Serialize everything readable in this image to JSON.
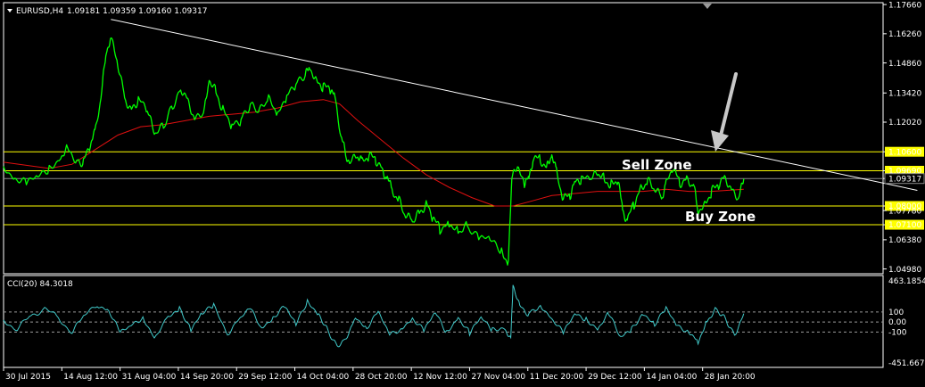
{
  "header": {
    "symbol": "EURUSD,H4",
    "ohlc": "1.09181 1.09359 1.09160 1.09317"
  },
  "indicator": {
    "label": "CCI(20) 84.3018",
    "y_ticks": [
      "463.1854",
      "100",
      "0.00",
      "-100",
      "-451.6679"
    ]
  },
  "annotations": {
    "sell_zone": "Sell Zone",
    "buy_zone": "Buy Zone"
  },
  "colors": {
    "background": "#000000",
    "price": "#00ff00",
    "moving_average": "#e01010",
    "trendline": "#ffffff",
    "level": "#ffff00",
    "cci": "#40c8c8",
    "arrow": "#c8c8c8"
  },
  "chart_data": {
    "type": "line",
    "x_ticks": [
      "30 Jul 2015",
      "14 Aug 12:00",
      "31 Aug 04:00",
      "14 Sep 20:00",
      "29 Sep 12:00",
      "14 Oct 04:00",
      "28 Oct 20:00",
      "12 Nov 12:00",
      "27 Nov 04:00",
      "11 Dec 20:00",
      "29 Dec 12:00",
      "14 Jan 04:00",
      "28 Jan 20:00"
    ],
    "y_ticks": [
      "1.17660",
      "1.16260",
      "1.14860",
      "1.13420",
      "1.12020",
      "1.10600",
      "1.09690",
      "1.09317",
      "1.08000",
      "1.07780",
      "1.07100",
      "1.06380",
      "1.04980"
    ],
    "ylim": [
      1.0475,
      1.1775
    ],
    "price_path": [
      [
        0,
        1.099
      ],
      [
        0.5,
        1.094
      ],
      [
        1,
        1.091
      ],
      [
        1.5,
        1.093
      ],
      [
        2,
        1.098
      ],
      [
        2.5,
        1.104
      ],
      [
        2.8,
        1.108
      ],
      [
        3.2,
        1.102
      ],
      [
        3.5,
        1.101
      ],
      [
        3.8,
        1.109
      ],
      [
        4.0,
        1.115
      ],
      [
        4.3,
        1.135
      ],
      [
        4.5,
        1.155
      ],
      [
        4.7,
        1.16
      ],
      [
        5.0,
        1.148
      ],
      [
        5.3,
        1.132
      ],
      [
        5.6,
        1.126
      ],
      [
        5.9,
        1.131
      ],
      [
        6.3,
        1.125
      ],
      [
        6.6,
        1.115
      ],
      [
        7.0,
        1.118
      ],
      [
        7.4,
        1.128
      ],
      [
        7.8,
        1.136
      ],
      [
        8.1,
        1.13
      ],
      [
        8.4,
        1.121
      ],
      [
        8.8,
        1.126
      ],
      [
        9.0,
        1.141
      ],
      [
        9.3,
        1.135
      ],
      [
        9.6,
        1.126
      ],
      [
        10.0,
        1.118
      ],
      [
        10.4,
        1.121
      ],
      [
        10.8,
        1.128
      ],
      [
        11.2,
        1.125
      ],
      [
        11.6,
        1.131
      ],
      [
        12.0,
        1.123
      ],
      [
        12.4,
        1.132
      ],
      [
        12.8,
        1.138
      ],
      [
        13.2,
        1.142
      ],
      [
        13.4,
        1.147
      ],
      [
        13.7,
        1.14
      ],
      [
        14.0,
        1.137
      ],
      [
        14.3,
        1.136
      ],
      [
        14.5,
        1.132
      ],
      [
        14.8,
        1.112
      ],
      [
        15.0,
        1.104
      ],
      [
        15.2,
        1.101
      ],
      [
        15.5,
        1.104
      ],
      [
        15.7,
        1.101
      ],
      [
        16.0,
        1.104
      ],
      [
        16.3,
        1.102
      ],
      [
        16.6,
        1.097
      ],
      [
        16.8,
        1.093
      ],
      [
        17.0,
        1.088
      ],
      [
        17.3,
        1.083
      ],
      [
        17.6,
        1.075
      ],
      [
        17.9,
        1.073
      ],
      [
        18.2,
        1.077
      ],
      [
        18.5,
        1.081
      ],
      [
        18.8,
        1.074
      ],
      [
        19.1,
        1.069
      ],
      [
        19.5,
        1.072
      ],
      [
        19.9,
        1.068
      ],
      [
        20.3,
        1.071
      ],
      [
        20.8,
        1.065
      ],
      [
        21.3,
        1.063
      ],
      [
        21.8,
        1.058
      ],
      [
        22.1,
        1.053
      ],
      [
        22.25,
        1.094
      ],
      [
        22.5,
        1.097
      ],
      [
        22.8,
        1.091
      ],
      [
        23.0,
        1.093
      ],
      [
        23.2,
        1.104
      ],
      [
        23.5,
        1.102
      ],
      [
        23.8,
        1.099
      ],
      [
        24.0,
        1.105
      ],
      [
        24.2,
        1.096
      ],
      [
        24.5,
        1.083
      ],
      [
        24.8,
        1.085
      ],
      [
        25.0,
        1.091
      ],
      [
        25.3,
        1.093
      ],
      [
        25.7,
        1.092
      ],
      [
        26.0,
        1.096
      ],
      [
        26.3,
        1.093
      ],
      [
        26.6,
        1.09
      ],
      [
        26.9,
        1.092
      ],
      [
        27.1,
        1.078
      ],
      [
        27.3,
        1.073
      ],
      [
        27.6,
        1.081
      ],
      [
        27.9,
        1.089
      ],
      [
        28.2,
        1.092
      ],
      [
        28.5,
        1.088
      ],
      [
        28.8,
        1.084
      ],
      [
        29.0,
        1.09
      ],
      [
        29.3,
        1.098
      ],
      [
        29.6,
        1.091
      ],
      [
        29.9,
        1.093
      ],
      [
        30.2,
        1.09
      ],
      [
        30.4,
        1.078
      ],
      [
        30.7,
        1.081
      ],
      [
        31.0,
        1.087
      ],
      [
        31.3,
        1.09
      ],
      [
        31.6,
        1.094
      ],
      [
        31.9,
        1.087
      ],
      [
        32.2,
        1.084
      ],
      [
        32.4,
        1.093
      ]
    ],
    "moving_average": [
      [
        0,
        1.101
      ],
      [
        2,
        1.098
      ],
      [
        3,
        1.1
      ],
      [
        4,
        1.107
      ],
      [
        5,
        1.114
      ],
      [
        6,
        1.118
      ],
      [
        7,
        1.119
      ],
      [
        8,
        1.121
      ],
      [
        9,
        1.123
      ],
      [
        10,
        1.124
      ],
      [
        11,
        1.125
      ],
      [
        12,
        1.127
      ],
      [
        13,
        1.13
      ],
      [
        14,
        1.131
      ],
      [
        14.7,
        1.129
      ],
      [
        15.5,
        1.121
      ],
      [
        16.5,
        1.112
      ],
      [
        17.5,
        1.103
      ],
      [
        18.5,
        1.095
      ],
      [
        19.5,
        1.089
      ],
      [
        20.5,
        1.084
      ],
      [
        21.5,
        1.08
      ],
      [
        22.3,
        1.08
      ],
      [
        23,
        1.082
      ],
      [
        24,
        1.085
      ],
      [
        25,
        1.086
      ],
      [
        26,
        1.087
      ],
      [
        27,
        1.087
      ],
      [
        28,
        1.087
      ],
      [
        29,
        1.088
      ],
      [
        30,
        1.087
      ],
      [
        31,
        1.087
      ],
      [
        32.4,
        1.088
      ]
    ],
    "trendline": [
      [
        4.7,
        1.1695
      ],
      [
        40.0,
        1.0875
      ]
    ],
    "levels": [
      1.106,
      1.0969,
      1.08,
      1.071
    ],
    "current_price": 1.09317,
    "cci_ylim": [
      -451.6679,
      463.1854
    ],
    "cci_levels": [
      100,
      0,
      -100
    ],
    "cci_path": [
      [
        0,
        20
      ],
      [
        0.6,
        -70
      ],
      [
        1.2,
        60
      ],
      [
        1.8,
        140
      ],
      [
        2.4,
        30
      ],
      [
        3.0,
        -90
      ],
      [
        3.5,
        40
      ],
      [
        4.1,
        180
      ],
      [
        4.6,
        120
      ],
      [
        5.1,
        -120
      ],
      [
        5.6,
        -40
      ],
      [
        6.1,
        60
      ],
      [
        6.6,
        -150
      ],
      [
        7.2,
        30
      ],
      [
        7.7,
        150
      ],
      [
        8.2,
        -60
      ],
      [
        8.7,
        80
      ],
      [
        9.2,
        150
      ],
      [
        9.8,
        -110
      ],
      [
        10.3,
        20
      ],
      [
        10.8,
        120
      ],
      [
        11.3,
        -60
      ],
      [
        11.8,
        60
      ],
      [
        12.3,
        160
      ],
      [
        12.8,
        -40
      ],
      [
        13.3,
        200
      ],
      [
        13.8,
        90
      ],
      [
        14.2,
        -80
      ],
      [
        14.6,
        -230
      ],
      [
        15.0,
        -150
      ],
      [
        15.4,
        60
      ],
      [
        15.9,
        -50
      ],
      [
        16.4,
        90
      ],
      [
        16.9,
        -140
      ],
      [
        17.4,
        -60
      ],
      [
        17.9,
        50
      ],
      [
        18.4,
        -90
      ],
      [
        18.9,
        80
      ],
      [
        19.4,
        -100
      ],
      [
        19.9,
        60
      ],
      [
        20.4,
        -110
      ],
      [
        20.9,
        30
      ],
      [
        21.4,
        -80
      ],
      [
        21.9,
        -40
      ],
      [
        22.2,
        -170
      ],
      [
        22.3,
        380
      ],
      [
        22.6,
        160
      ],
      [
        23.0,
        80
      ],
      [
        23.5,
        180
      ],
      [
        24.0,
        40
      ],
      [
        24.5,
        -120
      ],
      [
        25.0,
        70
      ],
      [
        25.5,
        40
      ],
      [
        26.0,
        -60
      ],
      [
        26.5,
        80
      ],
      [
        27.0,
        -170
      ],
      [
        27.5,
        -60
      ],
      [
        28.0,
        100
      ],
      [
        28.5,
        -30
      ],
      [
        29.0,
        120
      ],
      [
        29.5,
        -40
      ],
      [
        30.0,
        -80
      ],
      [
        30.4,
        -190
      ],
      [
        30.8,
        20
      ],
      [
        31.2,
        140
      ],
      [
        31.6,
        40
      ],
      [
        32.0,
        -120
      ],
      [
        32.4,
        84
      ]
    ]
  }
}
